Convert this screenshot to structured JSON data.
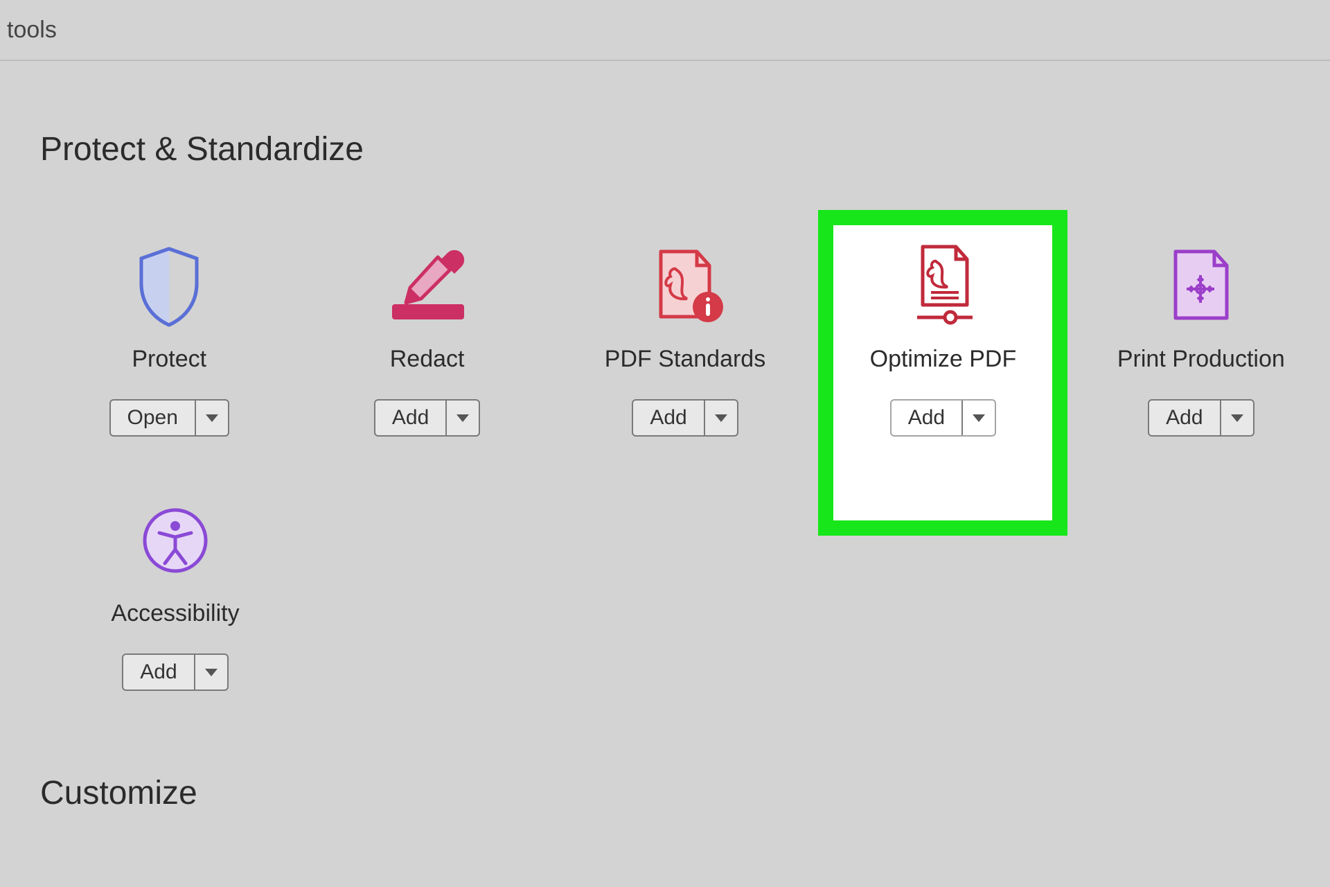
{
  "topbar": {
    "tools_label": "tools"
  },
  "sections": {
    "protect_standardize": {
      "title": "Protect & Standardize",
      "tools": [
        {
          "label": "Protect",
          "button": "Open",
          "icon": "shield-icon",
          "highlight": false
        },
        {
          "label": "Redact",
          "button": "Add",
          "icon": "redact-icon",
          "highlight": false
        },
        {
          "label": "PDF Standards",
          "button": "Add",
          "icon": "pdf-standards-icon",
          "highlight": false
        },
        {
          "label": "Optimize PDF",
          "button": "Add",
          "icon": "optimize-pdf-icon",
          "highlight": true
        },
        {
          "label": "Print Production",
          "button": "Add",
          "icon": "print-production-icon",
          "highlight": false
        },
        {
          "label": "Accessibility",
          "button": "Add",
          "icon": "accessibility-icon",
          "highlight": false
        }
      ]
    },
    "customize": {
      "title": "Customize"
    }
  },
  "colors": {
    "highlight_border": "#17e61a",
    "shield": "#5a6fd6",
    "redact": "#cc2f63",
    "standards": "#d43a47",
    "optimize": "#c02a3b",
    "print": "#9b3ec9",
    "accessibility": "#8a49d6"
  }
}
